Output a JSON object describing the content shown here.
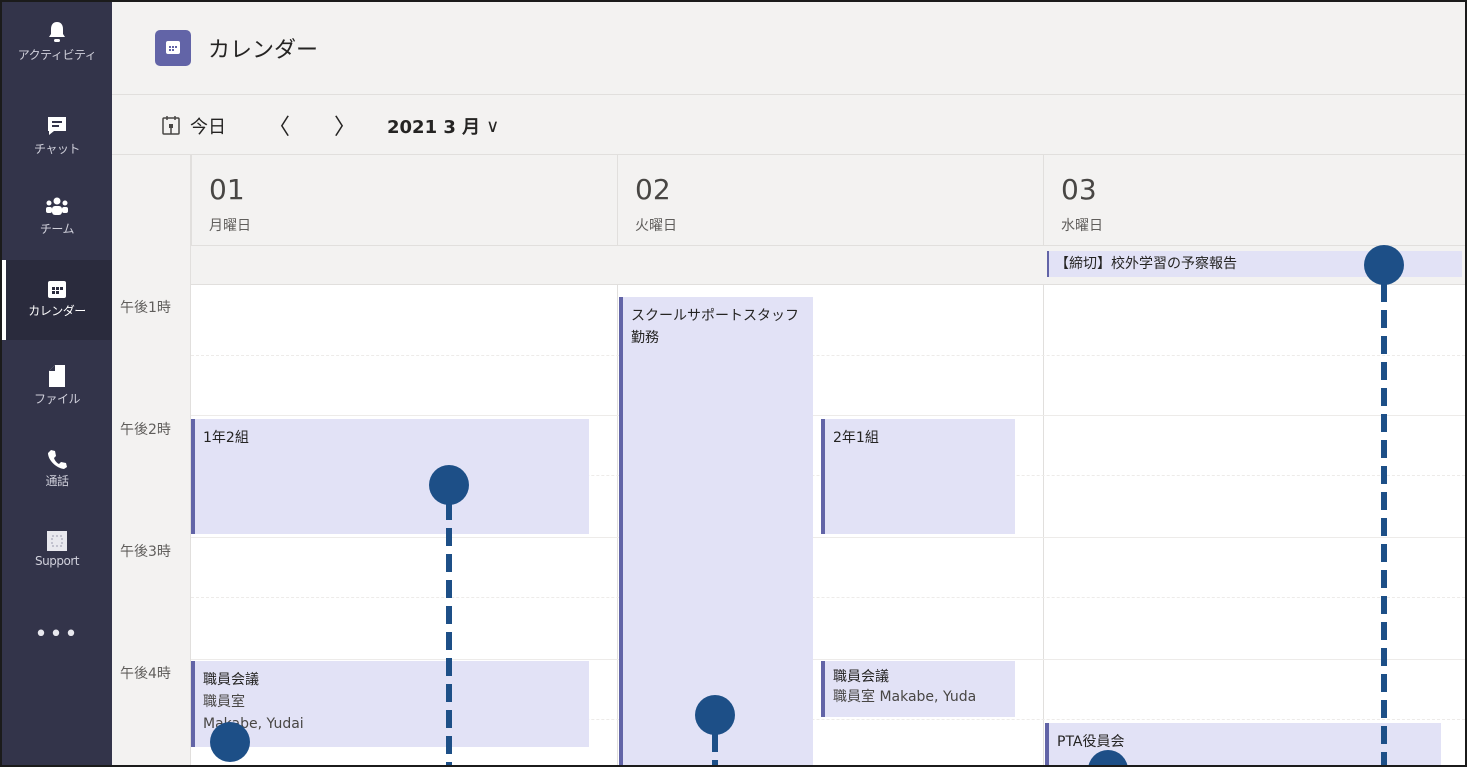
{
  "rail": {
    "items": [
      {
        "label": "アクティビティ",
        "icon": "bell-icon"
      },
      {
        "label": "チャット",
        "icon": "chat-icon"
      },
      {
        "label": "チーム",
        "icon": "teams-icon"
      },
      {
        "label": "カレンダー",
        "icon": "calendar-icon",
        "active": true
      },
      {
        "label": "ファイル",
        "icon": "file-icon"
      },
      {
        "label": "通話",
        "icon": "phone-icon"
      },
      {
        "label": "Support",
        "icon": "app-square-icon"
      }
    ],
    "more": "•••"
  },
  "header": {
    "title": "カレンダー"
  },
  "toolbar": {
    "today": "今日",
    "prev": "〈",
    "next": "〉",
    "month": "2021 3 月",
    "month_chevron": "∨"
  },
  "days": [
    {
      "num": "01",
      "name": "月曜日"
    },
    {
      "num": "02",
      "name": "火曜日"
    },
    {
      "num": "03",
      "name": "水曜日"
    }
  ],
  "hours": [
    "午後1時",
    "午後2時",
    "午後3時",
    "午後4時"
  ],
  "allday_events": [
    {
      "title": "【締切】校外学習の予察報告"
    }
  ],
  "events": {
    "e1": {
      "title": "1年2組"
    },
    "e2": {
      "title": "スクールサポートスタッフ",
      "line2": "勤務"
    },
    "e3": {
      "title": "2年1組"
    },
    "e4": {
      "title": "職員会議",
      "line2": "職員室",
      "line3": "Makabe, Yudai"
    },
    "e5": {
      "title": "職員会議",
      "line2": "職員室  Makabe, Yuda"
    },
    "e6": {
      "title": "PTA役員会"
    }
  },
  "colors": {
    "rail": "#33344a",
    "accent": "#6264a7",
    "event_bg": "#e2e2f6",
    "marker": "#1d4f87"
  }
}
